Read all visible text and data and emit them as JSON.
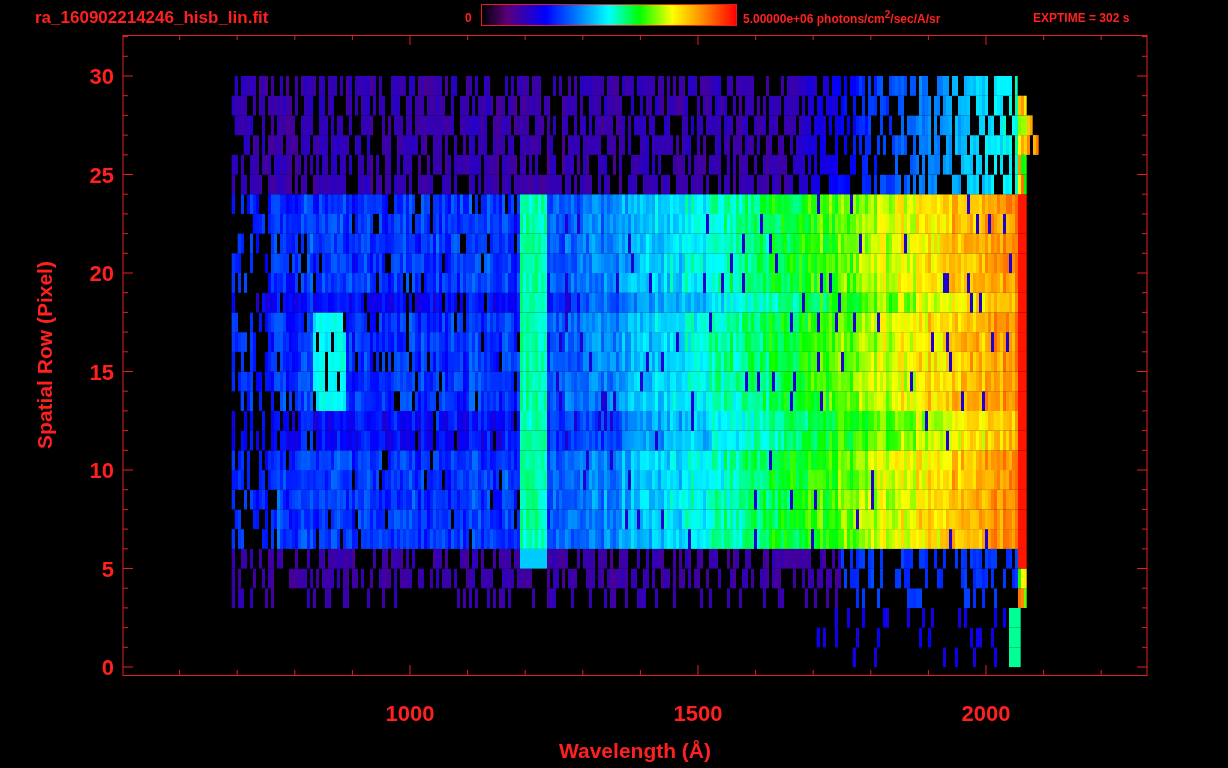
{
  "title": "ra_160902214246_hisb_lin.fit",
  "color_bar": {
    "min_label": "0",
    "max_label": "5.00000e+06 photons/cm$^{2}$/sec/A/sr"
  },
  "exposure": "EXPTIME = 302 s",
  "x_axis": {
    "title": "Wavelength (Å)",
    "tick_labels": [
      "1000",
      "1500",
      "2000"
    ]
  },
  "y_axis": {
    "title": "Spatial Row (Pixel)",
    "tick_labels": [
      "30",
      "25",
      "20",
      "15",
      "10",
      "5",
      "0"
    ]
  }
}
